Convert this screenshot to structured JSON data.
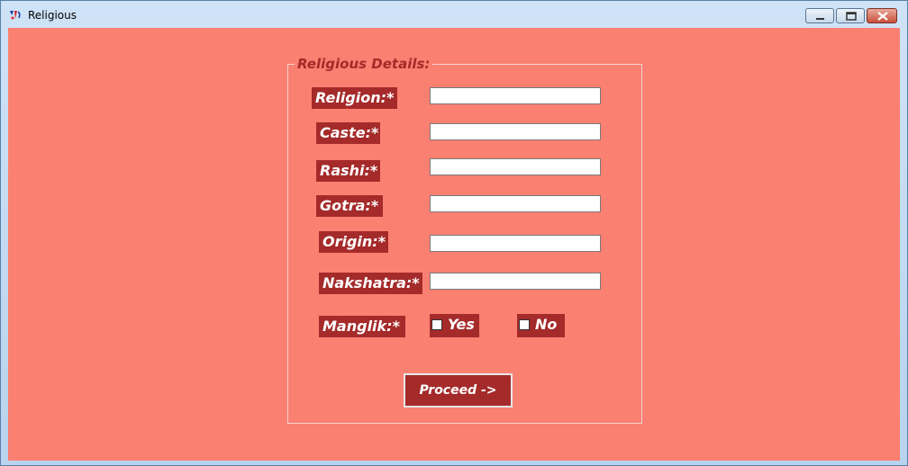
{
  "window": {
    "title": "Religious",
    "icon": "app-logo-icon",
    "controls": [
      "minimize-icon",
      "maximize-icon",
      "close-icon"
    ]
  },
  "form": {
    "legend": "Religious Details:",
    "fields": [
      {
        "label": "Religion:*",
        "value": ""
      },
      {
        "label": "Caste:*",
        "value": ""
      },
      {
        "label": "Rashi:*",
        "value": ""
      },
      {
        "label": "Gotra:*",
        "value": ""
      },
      {
        "label": "Origin:*",
        "value": ""
      },
      {
        "label": "Nakshatra:*",
        "value": ""
      }
    ],
    "manglik": {
      "label": "Manglik:*",
      "options": [
        {
          "label": "Yes",
          "checked": false
        },
        {
          "label": "No",
          "checked": false
        }
      ]
    },
    "proceed_label": "Proceed ->"
  },
  "colors": {
    "background": "#fa8072",
    "label_bg": "#a52a2a",
    "label_text": "#ffffff",
    "legend_text": "#a52a2a"
  }
}
